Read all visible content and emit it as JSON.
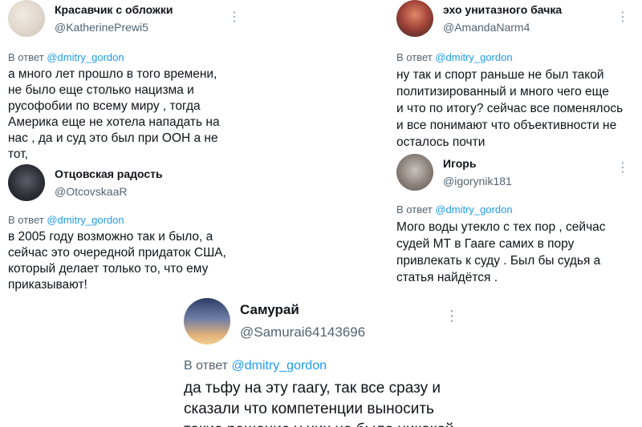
{
  "replying_prefix": "В ответ",
  "mention": "@dmitry_gordon",
  "more_icon": "⋮",
  "tweets": [
    {
      "name": "Красавчик с обложки",
      "handle": "@KatherinePrewi5",
      "text": "а много лет прошло в того времени,\nне было еще столько нацизма и\nрусофобии по всему миру , тогда\nАмерика еще не хотела нападать на\nнас , да и суд это был при ООН а не тот,\nкоторый вынес приговор"
    },
    {
      "name": "Отцовская радость",
      "handle": "@OtcovskaaR",
      "text": "в 2005 году возможно так и было, а\nсейчас это очередной придаток США,\nкоторый делает только то, что ему\nприказывают!"
    },
    {
      "name": "эхо унитазного бачка",
      "handle": "@AmandaNarm4",
      "text": "ну так и спорт раньше не был такой\nполитизированный и много чего еще\nи что по итогу? сейчас все поменялось\nи все понимают что объективности не\nосталось почти"
    },
    {
      "name": "Игорь",
      "handle": "@igorynik181",
      "text": "Мого воды утекло с тех пор , сейчас\nсудей МТ в Гааге самих в пору\nпривлекать к суду . Был бы судья а\nстатья найдётся ."
    },
    {
      "name": "Самурай",
      "handle": "@Samurai64143696",
      "text": "да тьфу на эту гаагу, так все сразу  и\nсказали что компетенции выносить\nтакие решение у них не было никакой"
    }
  ]
}
